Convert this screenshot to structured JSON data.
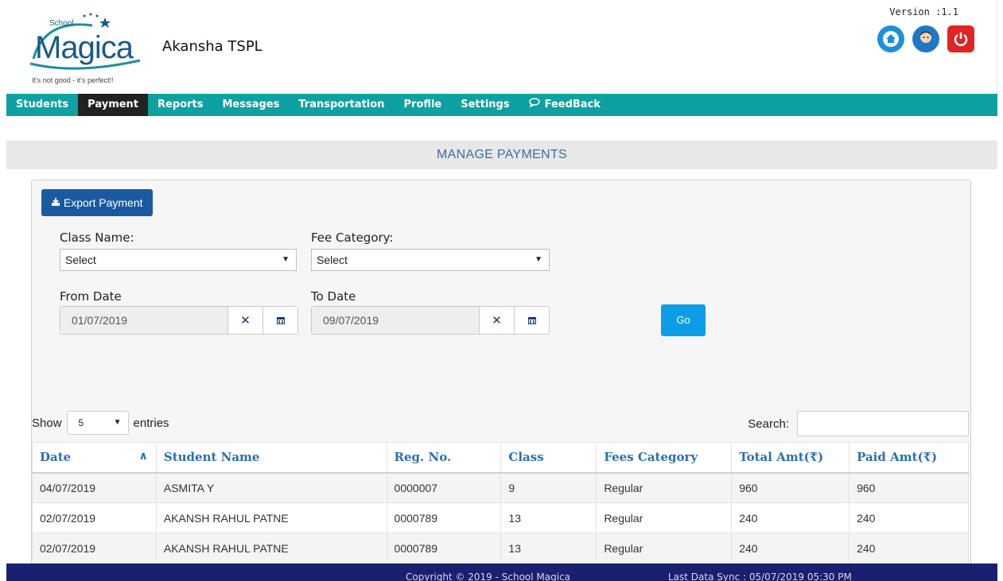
{
  "header": {
    "logo_word": "Magica",
    "logo_school": "School",
    "logo_tagline": "It's not good - it's perfect!!",
    "org_name": "Akansha TSPL",
    "version": "Version :1.1",
    "icons": [
      "home-icon",
      "profile-avatar-icon",
      "power-icon"
    ]
  },
  "nav": {
    "items": [
      "Students",
      "Payment",
      "Reports",
      "Messages",
      "Transportation",
      "Profile",
      "Settings",
      "FeedBack"
    ],
    "active": "Payment"
  },
  "page": {
    "title": "MANAGE PAYMENTS"
  },
  "form": {
    "export_label": "Export Payment",
    "class_label": "Class Name:",
    "class_value": "Select",
    "fee_label": "Fee Category:",
    "fee_value": "Select",
    "from_label": "From Date",
    "from_value": "01/07/2019",
    "to_label": "To Date",
    "to_value": "09/07/2019",
    "go_label": "Go"
  },
  "table_controls": {
    "show_label": "Show",
    "entries_value": "5",
    "entries_label": "entries",
    "search_label": "Search:",
    "search_value": ""
  },
  "table": {
    "columns": [
      "Date",
      "Student Name",
      "Reg. No.",
      "Class",
      "Fees Category",
      "Total Amt(₹)",
      "Paid Amt(₹)"
    ],
    "rows": [
      [
        "04/07/2019",
        "ASMITA Y",
        "0000007",
        "9",
        "Regular",
        "960",
        "960"
      ],
      [
        "02/07/2019",
        "AKANSH RAHUL PATNE",
        "0000789",
        "13",
        "Regular",
        "240",
        "240"
      ],
      [
        "02/07/2019",
        "AKANSH RAHUL PATNE",
        "0000789",
        "13",
        "Regular",
        "240",
        "240"
      ]
    ]
  },
  "footer": {
    "copyright": "Copyright © 2019 - School Magica",
    "sync": "Last Data Sync : 05/07/2019 05:30 PM"
  },
  "colors": {
    "nav_bg": "#0ea1a1",
    "nav_active": "#222222",
    "export_btn": "#1a5aa0",
    "go_btn": "#0b9ee6",
    "footer_bg": "#1a2070",
    "header_link": "#2a6fb0"
  }
}
